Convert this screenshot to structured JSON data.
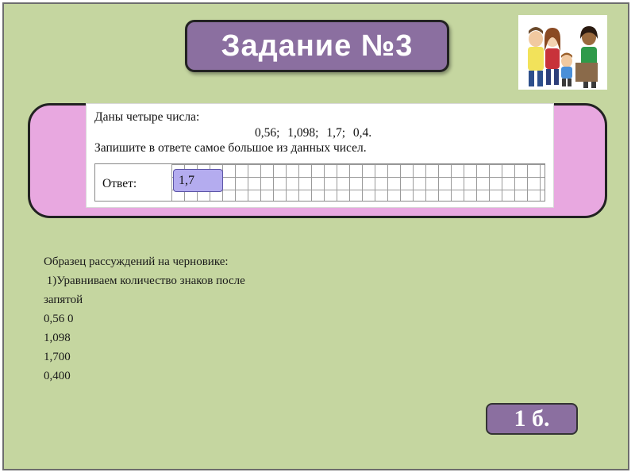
{
  "header": {
    "title": "Задание №3"
  },
  "illustration": {
    "icon": "family-icon",
    "colors": {
      "accent": "#8b6fa0"
    }
  },
  "task": {
    "line1": "Даны четыре числа:",
    "numbers": "0,56;  1,098;  1,7;  0,4.",
    "line2": "Запишите в ответе самое большое из данных чисел.",
    "answer_label": "Ответ:",
    "answer_value": "1,7"
  },
  "work": {
    "lines": [
      "Образец рассуждений на черновике:",
      " 1)Уравниваем количество знаков после",
      "запятой",
      "0,56 0",
      "1,098",
      "1,700",
      "0,400"
    ]
  },
  "score": {
    "label": "1 б."
  },
  "colors": {
    "background": "#c5d6a0",
    "title_box": "#8b6fa0",
    "task_frame": "#e8a8e0",
    "answer_box": "#b4acef"
  }
}
